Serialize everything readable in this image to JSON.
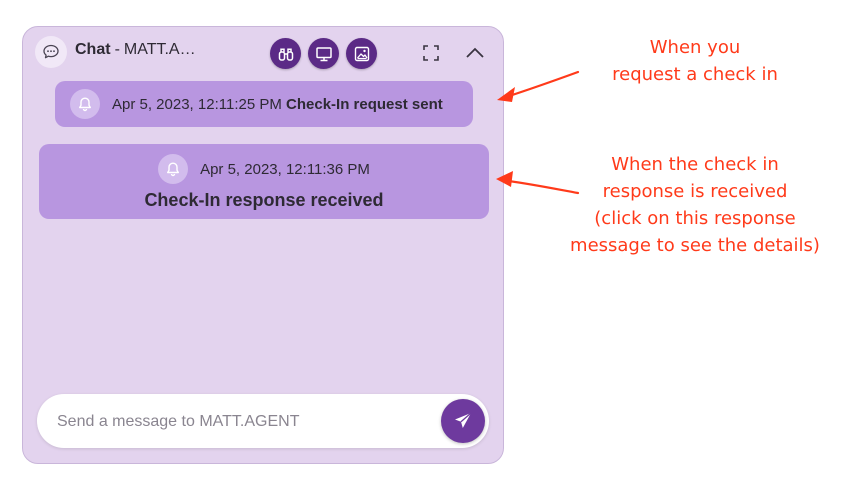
{
  "chat": {
    "title_bold": "Chat",
    "separator": "-",
    "agent_name_truncated": "MATT.A…",
    "toolbar_tools": [
      "binoculars-icon",
      "monitor-icon",
      "image-icon"
    ],
    "header_controls": [
      "expand-icon",
      "collapse-chevron-up-icon"
    ]
  },
  "messages": [
    {
      "timestamp": "Apr 5, 2023, 12:11:25 PM",
      "text": "Check-In request sent"
    },
    {
      "timestamp": "Apr 5, 2023, 12:11:36 PM",
      "text": "Check-In response received"
    }
  ],
  "composer": {
    "placeholder": "Send a message to MATT.AGENT",
    "value": ""
  },
  "annotations": {
    "request_lines": [
      "When you",
      "request a check in"
    ],
    "response_lines": [
      "When the check in",
      "response is received",
      "(click on this response",
      "message to see the details)"
    ]
  },
  "colors": {
    "panel_bg": "#e3d3ee",
    "message_bg": "#b896e0",
    "accent_purple": "#5b2a86",
    "send_button": "#6e3a9e",
    "annotation_red": "#ff3a1a"
  }
}
